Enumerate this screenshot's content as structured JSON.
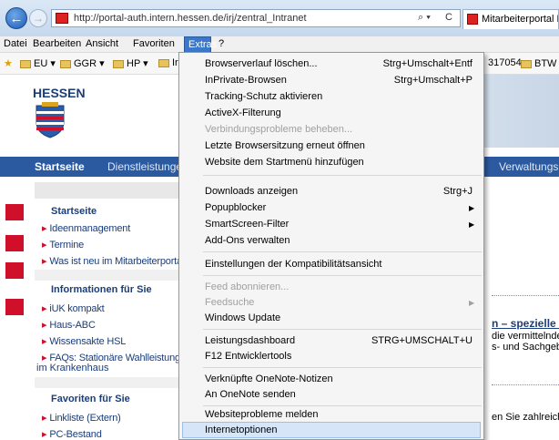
{
  "browser": {
    "url": "http://portal-auth.intern.hessen.de/irj/zentral_Intranet",
    "tab_title": "Mitarbeiterportal Hess",
    "back_icon": "←",
    "forward_icon": "→",
    "search_glyph": "⌕ ▾",
    "refresh_glyph": "C"
  },
  "menubar": [
    "Datei",
    "Bearbeiten",
    "Ansicht",
    "Favoriten",
    "Extras",
    "?"
  ],
  "favorites": [
    "EU ▾",
    "GGR ▾",
    "HP ▾",
    "Ir",
    "317054",
    "BTW ▾"
  ],
  "page": {
    "logo_title": "HESSEN",
    "nav": {
      "start": "Startseite",
      "dienst": "Dienstleistunge",
      "verw": "Verwaltungsr"
    },
    "sidebar": {
      "start_head": "Startseite",
      "items1": [
        "Ideenmanagement",
        "Termine",
        "Was ist neu im Mitarbeiterportal"
      ],
      "info_head": "Informationen für Sie",
      "items2": [
        "iUK kompakt",
        "Haus-ABC",
        "Wissensakte HSL",
        "FAQs: Stationäre Wahlleistunge"
      ],
      "items2_cont": "im Krankenhaus",
      "fav_head": "Favoriten für Sie",
      "items3": [
        "Linkliste (Extern)",
        "PC-Bestand"
      ]
    },
    "content": {
      "link": "n – spezielle Wo",
      "t1": "die vermittelnde Po",
      "t2": "s- und Sachgebiets",
      "t3": "en Sie zahlreiche n"
    }
  },
  "menu": {
    "items": [
      {
        "label": "Browserverlauf löschen...",
        "shortcut": "Strg+Umschalt+Entf"
      },
      {
        "label": "InPrivate-Browsen",
        "shortcut": "Strg+Umschalt+P"
      },
      {
        "label": "Tracking-Schutz aktivieren",
        "shortcut": ""
      },
      {
        "label": "ActiveX-Filterung",
        "shortcut": ""
      },
      {
        "label": "Verbindungsprobleme beheben...",
        "shortcut": ""
      },
      {
        "label": "Letzte Browsersitzung erneut öffnen",
        "shortcut": ""
      },
      {
        "label": "Website dem Startmenü hinzufügen",
        "shortcut": ""
      },
      {
        "label": "Downloads anzeigen",
        "shortcut": "Strg+J"
      },
      {
        "label": "Popupblocker",
        "shortcut": ""
      },
      {
        "label": "SmartScreen-Filter",
        "shortcut": ""
      },
      {
        "label": "Add-Ons verwalten",
        "shortcut": ""
      },
      {
        "label": "Einstellungen der Kompatibilitätsansicht",
        "shortcut": ""
      },
      {
        "label": "Feed abonnieren...",
        "shortcut": ""
      },
      {
        "label": "Feedsuche",
        "shortcut": ""
      },
      {
        "label": "Windows Update",
        "shortcut": ""
      },
      {
        "label": "Leistungsdashboard",
        "shortcut": "STRG+UMSCHALT+U"
      },
      {
        "label": "F12 Entwicklertools",
        "shortcut": ""
      },
      {
        "label": "Verknüpfte OneNote-Notizen",
        "shortcut": ""
      },
      {
        "label": "An OneNote senden",
        "shortcut": ""
      },
      {
        "label": "Websiteprobleme melden",
        "shortcut": ""
      },
      {
        "label": "Internetoptionen",
        "shortcut": ""
      }
    ]
  }
}
